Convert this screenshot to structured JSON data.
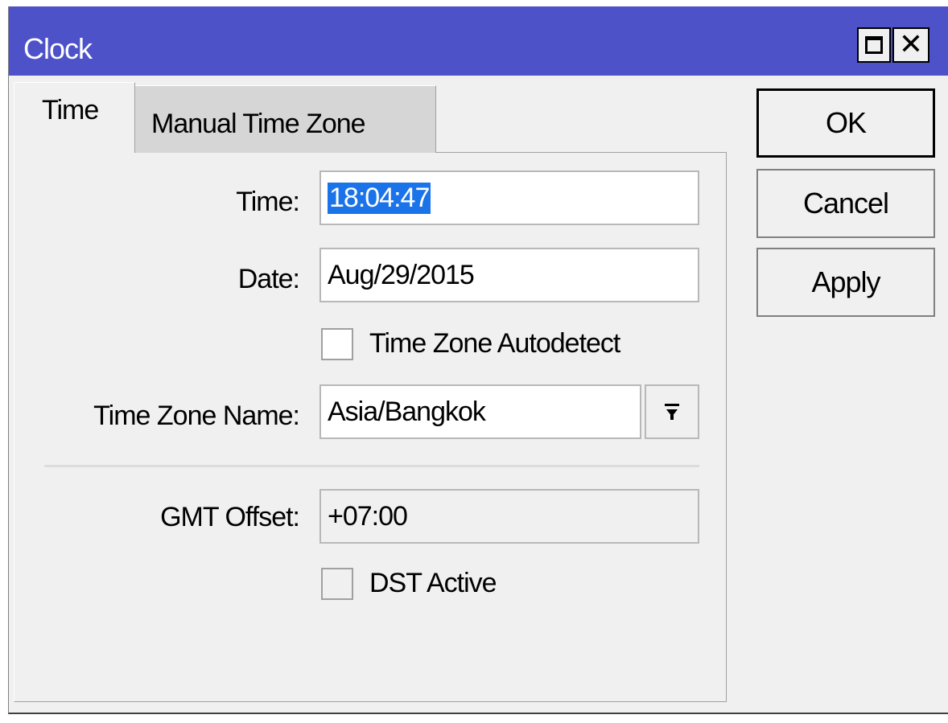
{
  "window": {
    "title": "Clock",
    "maximize_icon": "maximize-icon",
    "close_icon": "close-icon"
  },
  "tabs": [
    {
      "label": "Time",
      "active": true
    },
    {
      "label": "Manual Time Zone",
      "active": false
    }
  ],
  "form": {
    "time_label": "Time:",
    "time_value": "18:04:47",
    "date_label": "Date:",
    "date_value": "Aug/29/2015",
    "tz_autodetect_label": "Time Zone Autodetect",
    "tz_autodetect_checked": false,
    "tz_name_label": "Time Zone Name:",
    "tz_name_value": "Asia/Bangkok",
    "dropdown_icon": "dropdown-arrow-icon",
    "gmt_offset_label": "GMT Offset:",
    "gmt_offset_value": "+07:00",
    "dst_active_label": "DST Active",
    "dst_active_checked": false
  },
  "buttons": {
    "ok": "OK",
    "cancel": "Cancel",
    "apply": "Apply"
  },
  "colors": {
    "titlebar": "#4e52c9",
    "selection": "#1a73e8",
    "window_bg": "#f0f0f0"
  }
}
